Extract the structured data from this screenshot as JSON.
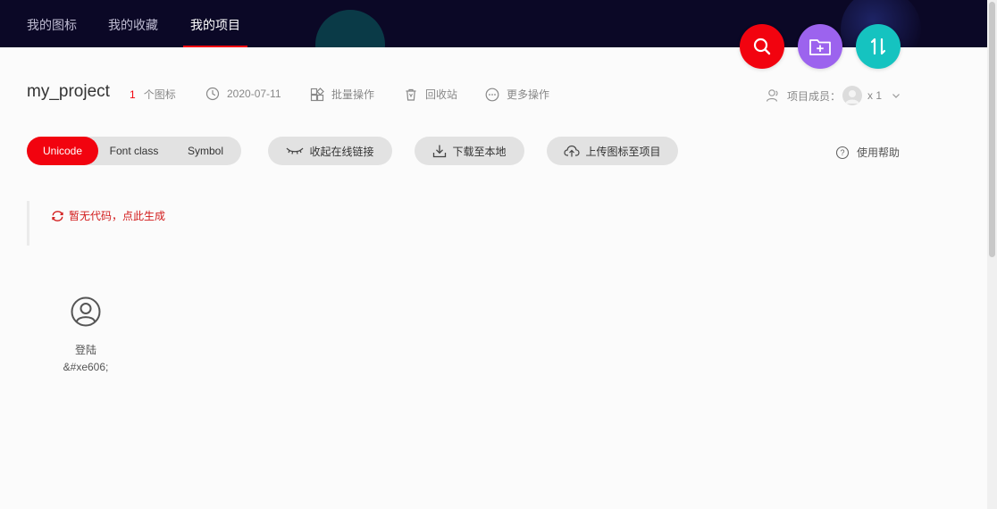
{
  "nav": {
    "items": [
      {
        "label": "我的图标"
      },
      {
        "label": "我的收藏"
      },
      {
        "label": "我的项目",
        "active": true
      }
    ]
  },
  "fabs": {
    "search": {
      "icon": "search-icon",
      "color": "#f2030f"
    },
    "add_folder": {
      "icon": "folder-add-icon",
      "color": "#9c63ee"
    },
    "sort": {
      "icon": "sort-icon",
      "color": "#15c3c0"
    }
  },
  "project": {
    "name": "my_project",
    "icon_count": "1",
    "icon_count_suffix": "个图标",
    "date": "2020-07-11",
    "batch_label": "批量操作",
    "recycle_label": "回收站",
    "more_label": "更多操作",
    "members_label": "项目成员：",
    "members_count": "x 1"
  },
  "tabs": [
    {
      "label": "Unicode",
      "active": true
    },
    {
      "label": "Font class"
    },
    {
      "label": "Symbol"
    }
  ],
  "actions": {
    "collapse_link": "收起在线链接",
    "download": "下载至本地",
    "upload": "上传图标至项目",
    "help": "使用帮助"
  },
  "code": {
    "empty_text": "暂无代码，点此生成"
  },
  "icons": [
    {
      "name": "登陆",
      "code": "&#xe606;",
      "glyph": "user-circle-icon"
    }
  ],
  "colors": {
    "topbar": "#0b0826",
    "accent": "#f2030f"
  }
}
